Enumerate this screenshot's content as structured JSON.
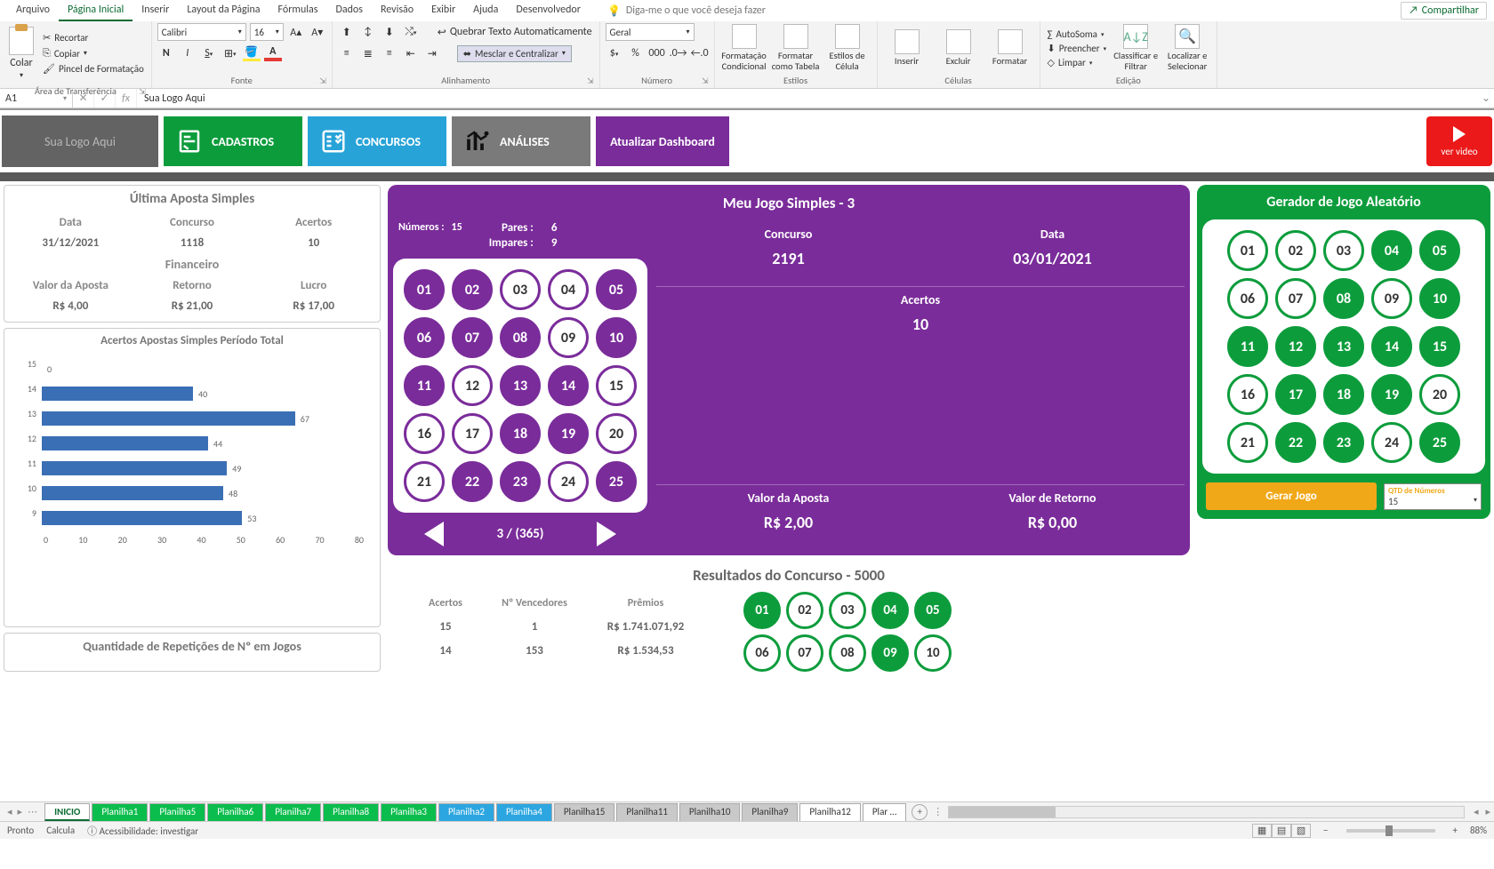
{
  "menu": {
    "items": [
      "Arquivo",
      "Página Inicial",
      "Inserir",
      "Layout da Página",
      "Fórmulas",
      "Dados",
      "Revisão",
      "Exibir",
      "Ajuda",
      "Desenvolvedor"
    ],
    "active": 1,
    "tell_me": "Diga-me o que você deseja fazer",
    "share": "Compartilhar"
  },
  "ribbon": {
    "clipboard": {
      "paste": "Colar",
      "cut": "Recortar",
      "copy": "Copiar",
      "format_painter": "Pincel de Formatação",
      "label": "Área de Transferência"
    },
    "font": {
      "name": "Calibri",
      "size": "16",
      "label": "Fonte"
    },
    "alignment": {
      "wrap": "Quebrar Texto Automaticamente",
      "merge": "Mesclar e Centralizar",
      "label": "Alinhamento"
    },
    "number": {
      "format": "Geral",
      "label": "Número"
    },
    "styles": {
      "cond": "Formatação Condicional",
      "table": "Formatar como Tabela",
      "cell": "Estilos de Célula",
      "label": "Estilos"
    },
    "cells": {
      "insert": "Inserir",
      "delete": "Excluir",
      "format": "Formatar",
      "label": "Células"
    },
    "editing": {
      "autosum": "AutoSoma",
      "fill": "Preencher",
      "clear": "Limpar",
      "sort": "Classificar e Filtrar",
      "find": "Localizar e Selecionar",
      "label": "Edição"
    }
  },
  "formula_bar": {
    "cell": "A1",
    "value": "Sua Logo Aqui"
  },
  "dash": {
    "logo": "Sua Logo Aqui",
    "nav": {
      "cadastros": "CADASTROS",
      "concursos": "CONCURSOS",
      "analises": "ANÁLISES",
      "atualizar": "Atualizar Dashboard",
      "video": "ver video"
    },
    "ultima": {
      "title": "Última Aposta Simples",
      "h": {
        "data": "Data",
        "concurso": "Concurso",
        "acertos": "Acertos"
      },
      "v": {
        "data": "31/12/2021",
        "concurso": "1118",
        "acertos": "10"
      },
      "fin_title": "Financeiro",
      "fh": {
        "aposta": "Valor da Aposta",
        "retorno": "Retorno",
        "lucro": "Lucro"
      },
      "fv": {
        "aposta": "R$ 4,00",
        "retorno": "R$ 21,00",
        "lucro": "R$ 17,00"
      }
    },
    "chart": {
      "title": "Acertos Apostas Simples Período Total"
    },
    "rep": {
      "title": "Quantidade de Repetições de Nº em Jogos"
    },
    "meu": {
      "title": "Meu Jogo Simples - 3",
      "numeros_label": "Números :",
      "numeros": "15",
      "pares_label": "Pares :",
      "pares": "6",
      "impares_label": "Impares :",
      "impares": "9",
      "concurso_h": "Concurso",
      "concurso": "2191",
      "data_h": "Data",
      "data": "03/01/2021",
      "acertos_h": "Acertos",
      "acertos": "10",
      "aposta_h": "Valor da Aposta",
      "aposta": "R$ 2,00",
      "retorno_h": "Valor de Retorno",
      "retorno": "R$ 0,00",
      "pager": "3 / (365)",
      "balls_on": [
        1,
        2,
        5,
        6,
        7,
        8,
        10,
        11,
        13,
        14,
        18,
        19,
        22,
        23,
        25
      ]
    },
    "gerador": {
      "title": "Gerador de Jogo Aleatório",
      "gerar": "Gerar Jogo",
      "qtd_label": "QTD de Números",
      "qtd": "15",
      "balls_on": [
        4,
        5,
        8,
        10,
        11,
        12,
        13,
        14,
        15,
        17,
        18,
        19,
        22,
        23,
        25
      ]
    },
    "resultados": {
      "title": "Resultados do Concurso - 5000",
      "h": {
        "acertos": "Acertos",
        "venc": "Nº Vencedores",
        "prem": "Prêmios"
      },
      "rows": [
        {
          "a": "15",
          "v": "1",
          "p": "R$ 1.741.071,92"
        },
        {
          "a": "14",
          "v": "153",
          "p": "R$ 1.534,53"
        }
      ],
      "balls_on": [
        1,
        4,
        5,
        9
      ]
    }
  },
  "chart_data": {
    "type": "bar",
    "orientation": "horizontal",
    "categories": [
      "15",
      "14",
      "13",
      "12",
      "11",
      "10",
      "9"
    ],
    "values": [
      0,
      40,
      67,
      44,
      49,
      48,
      53
    ],
    "title": "Acertos Apostas Simples Período Total",
    "xlabel": "",
    "ylabel": "",
    "xlim": [
      0,
      80
    ],
    "xticks": [
      0,
      10,
      20,
      30,
      40,
      50,
      60,
      70,
      80
    ]
  },
  "sheets": {
    "tabs": [
      {
        "name": "INICIO",
        "cls": "active"
      },
      {
        "name": "Planilha1",
        "cls": "green"
      },
      {
        "name": "Planilha5",
        "cls": "green"
      },
      {
        "name": "Planilha6",
        "cls": "green"
      },
      {
        "name": "Planilha7",
        "cls": "green"
      },
      {
        "name": "Planilha8",
        "cls": "green"
      },
      {
        "name": "Planilha3",
        "cls": "green"
      },
      {
        "name": "Planilha2",
        "cls": "blue"
      },
      {
        "name": "Planilha4",
        "cls": "blue"
      },
      {
        "name": "Planilha15",
        "cls": "gray"
      },
      {
        "name": "Planilha11",
        "cls": "gray"
      },
      {
        "name": "Planilha10",
        "cls": "gray"
      },
      {
        "name": "Planilha9",
        "cls": "gray"
      },
      {
        "name": "Planilha12",
        "cls": ""
      },
      {
        "name": "Plar …",
        "cls": ""
      }
    ]
  },
  "status": {
    "ready": "Pronto",
    "calc": "Calcula",
    "access": "Acessibilidade: investigar",
    "zoom": "88%"
  }
}
